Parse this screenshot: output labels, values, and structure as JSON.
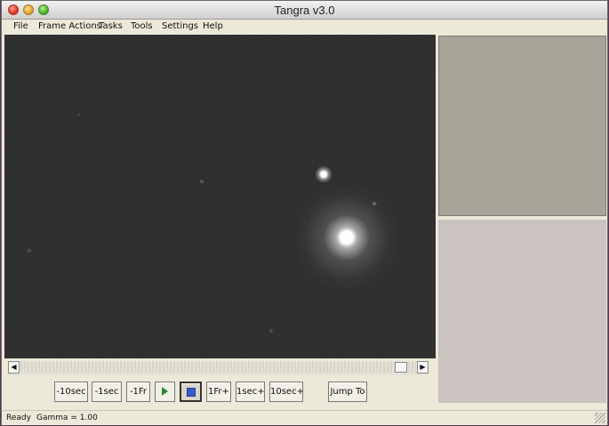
{
  "window": {
    "title": "Tangra v3.0"
  },
  "menu": {
    "items": [
      "File",
      "Frame Actions",
      "Tasks",
      "Tools",
      "Settings",
      "Help"
    ]
  },
  "controls": {
    "back_10sec": "-10sec",
    "back_1sec": "-1sec",
    "back_1fr": "-1Fr",
    "forward_1fr": "1Fr+",
    "forward_1sec": "1sec+",
    "forward_10sec": "10sec+",
    "jump_to": "Jump To"
  },
  "status": {
    "state": "Ready",
    "gamma": "Gamma = 1.00"
  },
  "icons": {
    "play": "play-icon",
    "stop": "stop-icon",
    "scroll_left": "arrow-left-icon",
    "scroll_right": "arrow-right-icon"
  }
}
